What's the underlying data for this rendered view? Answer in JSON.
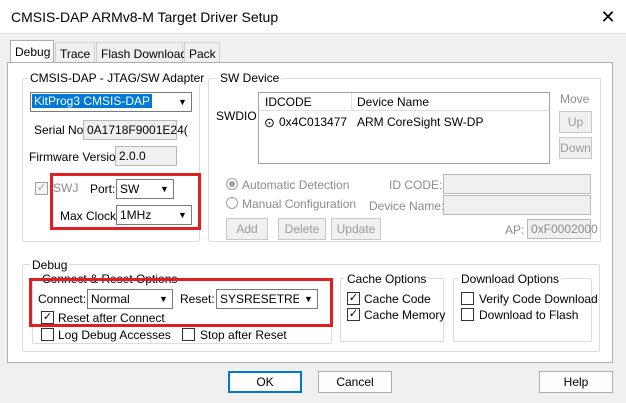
{
  "window": {
    "title": "CMSIS-DAP ARMv8-M Target Driver Setup",
    "close_glyph": "✕"
  },
  "tabs": [
    {
      "label": "Debug"
    },
    {
      "label": "Trace"
    },
    {
      "label": "Flash Download"
    },
    {
      "label": "Pack"
    }
  ],
  "adapter": {
    "group_label": "CMSIS-DAP - JTAG/SW Adapter",
    "device_selected": "KitProg3 CMSIS-DAP",
    "serial_label": "Serial No:",
    "serial_value": "0A1718F9001E24(",
    "firmware_label": "Firmware Version:",
    "firmware_value": "2.0.0",
    "swj_label": "SWJ",
    "port_label": "Port:",
    "port_value": "SW",
    "maxclock_label": "Max Clock:",
    "maxclock_value": "1MHz"
  },
  "sw_device": {
    "group_label": "SW Device",
    "swdio_label": "SWDIO",
    "col_idcode": "IDCODE",
    "col_device_name": "Device Name",
    "row_idcode": "0x4C013477",
    "row_device_name": "ARM CoreSight SW-DP",
    "move_label": "Move",
    "up_label": "Up",
    "down_label": "Down",
    "auto_detect_label": "Automatic Detection",
    "manual_config_label": "Manual Configuration",
    "idcode_label": "ID CODE:",
    "device_name_label": "Device Name:",
    "add_label": "Add",
    "delete_label": "Delete",
    "update_label": "Update",
    "ap_label": "AP:",
    "ap_value": "0xF0002000"
  },
  "debug": {
    "group_label": "Debug",
    "connect_reset_label": "Connect & Reset Options",
    "connect_label": "Connect:",
    "connect_value": "Normal",
    "reset_label": "Reset:",
    "reset_value": "SYSRESETREQ",
    "reset_after_connect_label": "Reset after Connect",
    "log_debug_label": "Log Debug Accesses",
    "stop_after_reset_label": "Stop after Reset"
  },
  "cache": {
    "group_label": "Cache Options",
    "cache_code_label": "Cache Code",
    "cache_memory_label": "Cache Memory"
  },
  "download": {
    "group_label": "Download Options",
    "verify_label": "Verify Code Download",
    "download_flash_label": "Download to Flash"
  },
  "buttons": {
    "ok": "OK",
    "cancel": "Cancel",
    "help": "Help"
  },
  "colors": {
    "highlight_red": "#e02020",
    "selection_blue": "#0078d7"
  }
}
